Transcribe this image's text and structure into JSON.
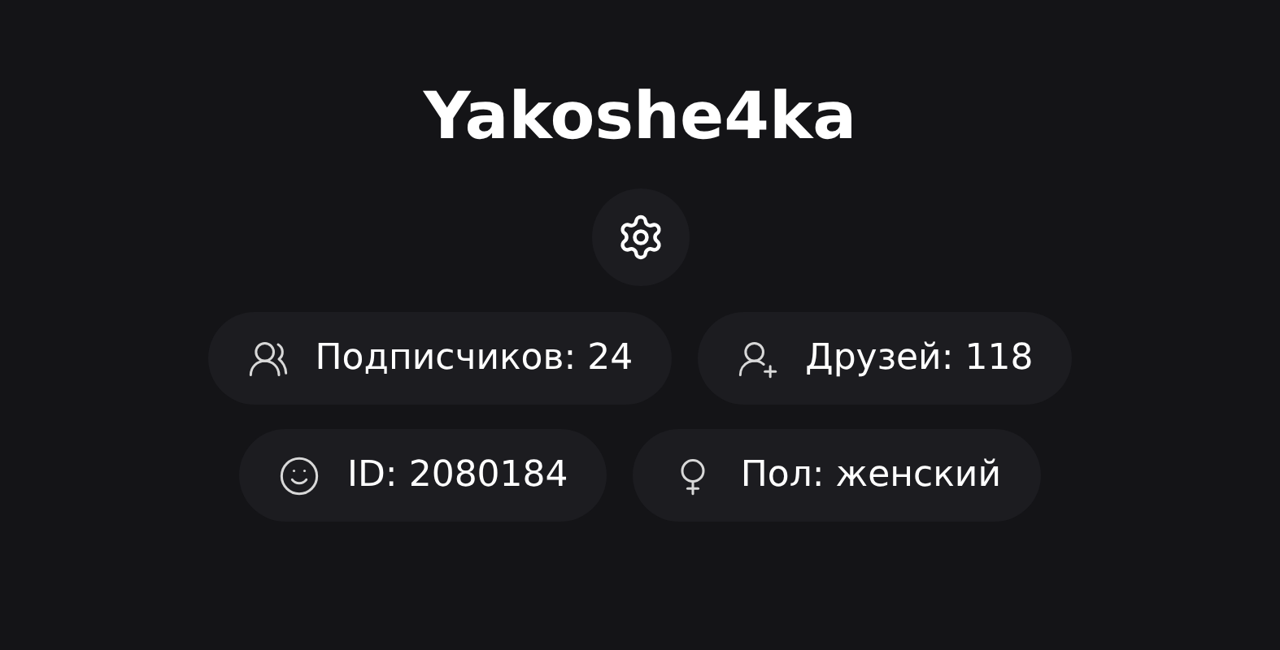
{
  "profile": {
    "username": "Yakoshe4ka"
  },
  "stats_rows": [
    [
      {
        "kind": "followers",
        "text": "Подписчиков: 24"
      },
      {
        "kind": "friends",
        "text": "Друзей: 118"
      }
    ],
    [
      {
        "kind": "id",
        "text": "ID: 2080184"
      },
      {
        "kind": "gender",
        "text": "Пол: женский"
      }
    ]
  ]
}
